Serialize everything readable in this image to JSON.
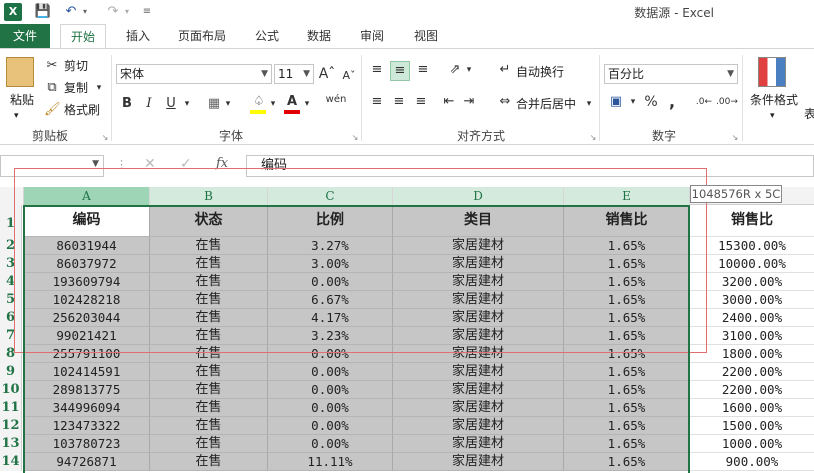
{
  "window": {
    "title": "数据源 - Excel"
  },
  "tabs": [
    "文件",
    "开始",
    "插入",
    "页面布局",
    "公式",
    "数据",
    "审阅",
    "视图"
  ],
  "ribbon": {
    "clipboard": {
      "paste": "粘贴",
      "cut": "剪切",
      "copy": "复制",
      "format_painter": "格式刷",
      "label": "剪贴板"
    },
    "font": {
      "name": "宋体",
      "size": "11",
      "label": "字体",
      "bold": "B",
      "italic": "I",
      "underline": "U",
      "phonetic": "wén"
    },
    "alignment": {
      "wrap": "自动换行",
      "merge": "合并后居中",
      "label": "对齐方式"
    },
    "number": {
      "format": "百分比",
      "percent": "%",
      "comma": ",",
      "label": "数字"
    },
    "styles": {
      "conditional": "条件格式",
      "more": "表"
    }
  },
  "formula_bar": {
    "name_box": "",
    "fx": "fx",
    "value": "编码"
  },
  "tooltip": "1048576R x 5C",
  "columns": [
    "A",
    "B",
    "C",
    "D",
    "E"
  ],
  "rows": [
    "1",
    "2",
    "3",
    "4",
    "5",
    "6",
    "7",
    "8",
    "9",
    "10",
    "11",
    "12",
    "13",
    "14"
  ],
  "table": {
    "headers": [
      "编码",
      "状态",
      "比例",
      "类目",
      "销售比"
    ],
    "extra_header": "销售比",
    "data": [
      [
        "86031944",
        "在售",
        "3.27%",
        "家居建材",
        "1.65%",
        "15300.00%"
      ],
      [
        "86037972",
        "在售",
        "3.00%",
        "家居建材",
        "1.65%",
        "10000.00%"
      ],
      [
        "193609794",
        "在售",
        "0.00%",
        "家居建材",
        "1.65%",
        "3200.00%"
      ],
      [
        "102428218",
        "在售",
        "6.67%",
        "家居建材",
        "1.65%",
        "3000.00%"
      ],
      [
        "256203044",
        "在售",
        "4.17%",
        "家居建材",
        "1.65%",
        "2400.00%"
      ],
      [
        "99021421",
        "在售",
        "3.23%",
        "家居建材",
        "1.65%",
        "3100.00%"
      ],
      [
        "255791100",
        "在售",
        "0.00%",
        "家居建材",
        "1.65%",
        "1800.00%"
      ],
      [
        "102414591",
        "在售",
        "0.00%",
        "家居建材",
        "1.65%",
        "2200.00%"
      ],
      [
        "289813775",
        "在售",
        "0.00%",
        "家居建材",
        "1.65%",
        "2200.00%"
      ],
      [
        "344996094",
        "在售",
        "0.00%",
        "家居建材",
        "1.65%",
        "1600.00%"
      ],
      [
        "123473322",
        "在售",
        "0.00%",
        "家居建材",
        "1.65%",
        "1500.00%"
      ],
      [
        "103780723",
        "在售",
        "0.00%",
        "家居建材",
        "1.65%",
        "1000.00%"
      ],
      [
        "94726871",
        "在售",
        "11.11%",
        "家居建材",
        "1.65%",
        "900.00%"
      ]
    ]
  },
  "colors": {
    "accent": "#217346",
    "selection": "#c6c6c6",
    "annotation": "#e07070"
  }
}
